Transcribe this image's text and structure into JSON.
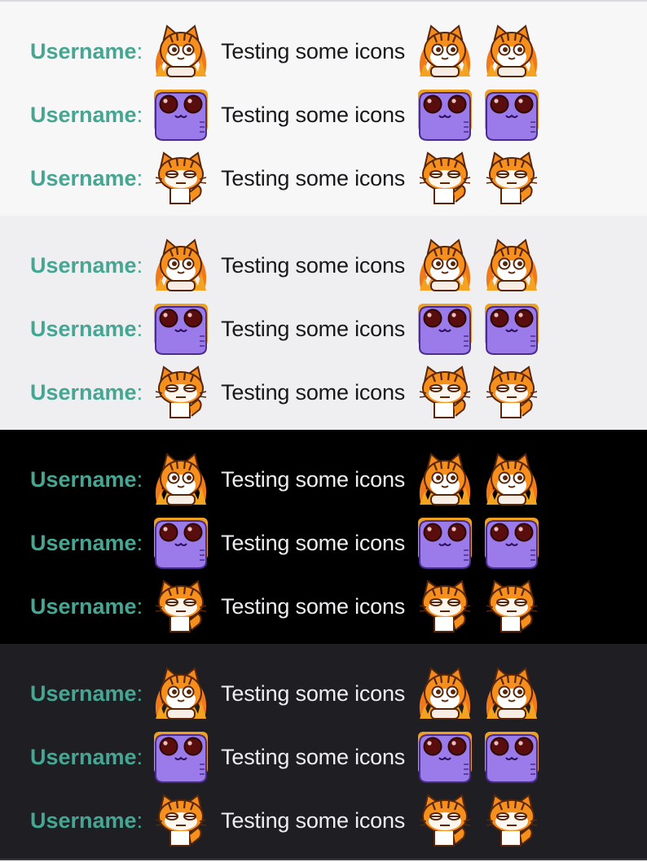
{
  "colors": {
    "username": "#45a693",
    "themes": [
      {
        "background": "#f7f7f8",
        "text": "#18181b"
      },
      {
        "background": "#efeff1",
        "text": "#18181b"
      },
      {
        "background": "#000000",
        "text": "#efeff1"
      },
      {
        "background": "#1f1f23",
        "text": "#efeff1"
      }
    ]
  },
  "username_label": "Username",
  "colon": ":",
  "message": "Testing some icons",
  "emotes": [
    "cat-peek-icon",
    "purple-cat-icon",
    "cat-deadpan-icon"
  ],
  "panels": [
    {
      "theme": "light"
    },
    {
      "theme": "light-gray"
    },
    {
      "theme": "dark"
    },
    {
      "theme": "dark-gray"
    }
  ]
}
